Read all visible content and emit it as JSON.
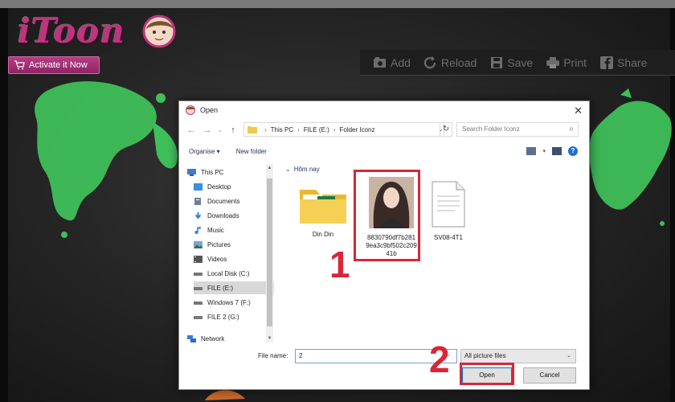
{
  "app": {
    "name": "iToon",
    "activate_label": "Activate it Now",
    "toolbar": [
      {
        "label": "Add",
        "icon": "add-photo-icon"
      },
      {
        "label": "Reload",
        "icon": "reload-icon"
      },
      {
        "label": "Save",
        "icon": "save-icon"
      },
      {
        "label": "Print",
        "icon": "print-icon"
      },
      {
        "label": "Share",
        "icon": "facebook-icon"
      }
    ],
    "colors": {
      "brand": "#c0337f",
      "splash": "#3fbf5a",
      "annotation": "#d8263a"
    }
  },
  "dialog": {
    "title": "Open",
    "breadcrumb": [
      "This PC",
      "FILE (E:)",
      "Folder Iconz"
    ],
    "search_placeholder": "Search Folder Iconz",
    "organise_label": "Organise ▾",
    "new_folder_label": "New folder",
    "nav": [
      {
        "label": "This PC",
        "icon": "computer-icon"
      },
      {
        "label": "Desktop",
        "icon": "desktop-icon"
      },
      {
        "label": "Documents",
        "icon": "documents-icon"
      },
      {
        "label": "Downloads",
        "icon": "downloads-icon"
      },
      {
        "label": "Music",
        "icon": "music-icon"
      },
      {
        "label": "Pictures",
        "icon": "pictures-icon"
      },
      {
        "label": "Videos",
        "icon": "videos-icon"
      },
      {
        "label": "Local Disk (C:)",
        "icon": "drive-icon"
      },
      {
        "label": "FILE (E:)",
        "icon": "drive-icon",
        "selected": true
      },
      {
        "label": "Windows 7 (F:)",
        "icon": "drive-icon"
      },
      {
        "label": "FILE 2 (G:)",
        "icon": "drive-icon"
      },
      {
        "label": "Network",
        "icon": "network-icon"
      }
    ],
    "group_label": "Hôm nay",
    "files": [
      {
        "name": "Din Din",
        "type": "folder"
      },
      {
        "name_lines": [
          "8830790df7b281",
          "9ea3c9bf502c209",
          "41b"
        ],
        "type": "image"
      },
      {
        "name": "SV08-4T1",
        "type": "document"
      }
    ],
    "filename_label": "File name:",
    "filename_value": "2",
    "filter_value": "All picture files",
    "open_label": "Open",
    "cancel_label": "Cancel"
  },
  "annotations": {
    "step1": "1",
    "step2": "2"
  }
}
